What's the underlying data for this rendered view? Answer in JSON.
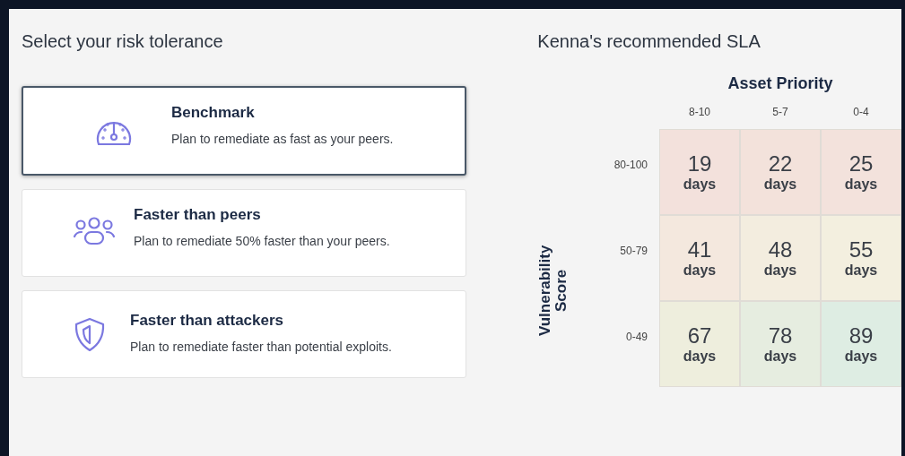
{
  "left_title": "Select your risk tolerance",
  "options": [
    {
      "kind": "gauge",
      "title": "Benchmark",
      "description": "Plan to remediate as fast as your peers.",
      "selected": true
    },
    {
      "kind": "people",
      "title": "Faster than peers",
      "description": "Plan to remediate 50% faster than your peers.",
      "selected": false
    },
    {
      "kind": "shield",
      "title": "Faster than attackers",
      "description": "Plan to remediate faster than potential exploits.",
      "selected": false
    }
  ],
  "right_title": "Kenna's recommended SLA",
  "sla": {
    "column_axis": "Asset Priority",
    "row_axis": "Vulnerability Score",
    "columns": [
      "8-10",
      "5-7",
      "0-4"
    ],
    "rows": [
      {
        "label": "80-100",
        "cells": [
          {
            "value": "19",
            "unit": "days",
            "color": "#f3e1dc"
          },
          {
            "value": "22",
            "unit": "days",
            "color": "#f3e2db"
          },
          {
            "value": "25",
            "unit": "days",
            "color": "#f3e2dc"
          }
        ]
      },
      {
        "label": "50-79",
        "cells": [
          {
            "value": "41",
            "unit": "days",
            "color": "#f4e8de"
          },
          {
            "value": "48",
            "unit": "days",
            "color": "#f3eddf"
          },
          {
            "value": "55",
            "unit": "days",
            "color": "#f3efdf"
          }
        ]
      },
      {
        "label": "0-49",
        "cells": [
          {
            "value": "67",
            "unit": "days",
            "color": "#eeeedd"
          },
          {
            "value": "78",
            "unit": "days",
            "color": "#e6ede0"
          },
          {
            "value": "89",
            "unit": "days",
            "color": "#deede3"
          }
        ]
      }
    ]
  }
}
